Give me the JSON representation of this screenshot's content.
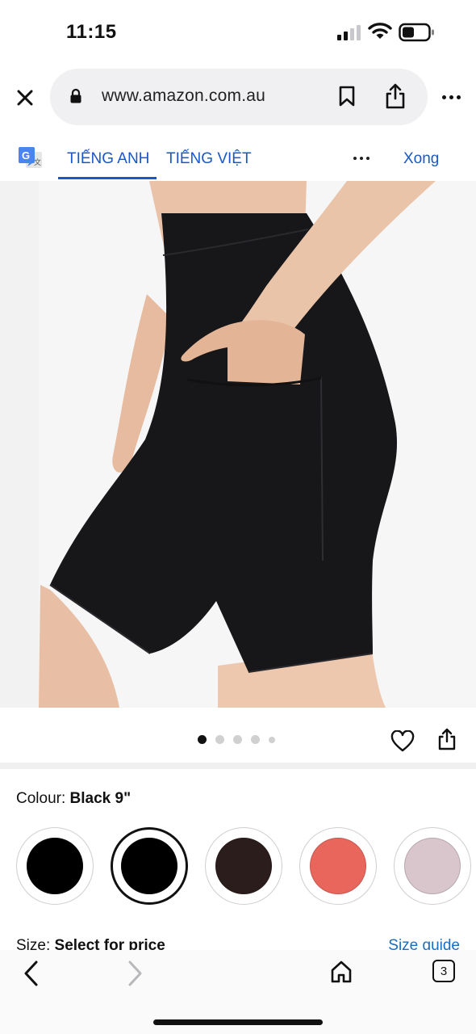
{
  "status_bar": {
    "time": "11:15",
    "signal_bars": 2,
    "battery_level": 0.45
  },
  "browser": {
    "url": "www.amazon.com.au",
    "tab_count": "3"
  },
  "translate_bar": {
    "source_language": "TIẾNG ANH",
    "target_language": "TIẾNG VIỆT",
    "done_label": "Xong",
    "accent_color": "#1a57c8"
  },
  "product": {
    "image_description_icon": "product-photo",
    "carousel": {
      "total_dots": 5,
      "active_index": 0
    },
    "colour_label": "Colour: ",
    "colour_value": "Black 9\"",
    "swatches": [
      {
        "name": "black",
        "color": "#000000",
        "selected": false
      },
      {
        "name": "black-9",
        "color": "#000000",
        "selected": true
      },
      {
        "name": "dark-brown",
        "color": "#2b1d1b",
        "selected": false
      },
      {
        "name": "coral",
        "color": "#e8665c",
        "selected": false
      },
      {
        "name": "lilac-grey",
        "color": "#d8c6cc",
        "selected": false
      }
    ],
    "size_label": "Size: ",
    "size_value": "Select for price",
    "size_guide": "Size guide"
  }
}
